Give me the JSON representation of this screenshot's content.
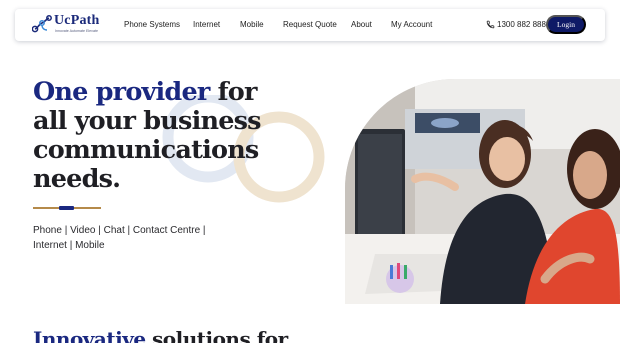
{
  "brand": {
    "name": "UcPath",
    "tagline": "Innovate Automate Elevate"
  },
  "nav": {
    "items": [
      "Phone Systems",
      "Internet",
      "Mobile",
      "Request Quote",
      "About",
      "My Account"
    ],
    "phone": "1300 882 888",
    "login": "Login"
  },
  "hero": {
    "title_accent": "One provider",
    "title_rest": "for all your business communications needs.",
    "services_line1": "Phone | Video | Chat | Contact Centre |",
    "services_line2": "Internet | Mobile",
    "image_alt": "Two women looking at a computer screen in an office"
  },
  "section2": {
    "heading_accent": "Innovative",
    "heading_rest": "solutions for"
  },
  "colors": {
    "navy": "#1a2880",
    "gold": "#b58a4a",
    "ring_gold": "#efe3cf",
    "ring_blue": "#e2e8f2"
  },
  "icons": {
    "phone": "phone-icon",
    "logo": "ucpath-logo-icon"
  }
}
